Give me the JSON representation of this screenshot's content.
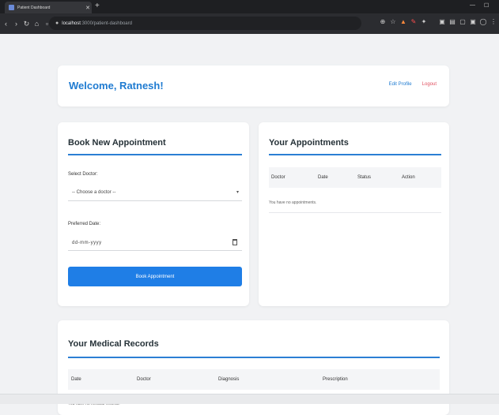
{
  "browser": {
    "tab_title": "Patient Dashboard",
    "url_host": "localhost",
    "url_path": ":3000/patient-dashboard"
  },
  "header": {
    "welcome": "Welcome, Ratnesh!",
    "edit_profile": "Edit Profile",
    "logout": "Logout"
  },
  "book": {
    "title": "Book New Appointment",
    "doctor_label": "Select Doctor:",
    "doctor_placeholder": "-- Choose a doctor --",
    "date_label": "Preferred Date:",
    "date_placeholder": "dd-mm-yyyy",
    "button": "Book Appointment"
  },
  "appointments": {
    "title": "Your Appointments",
    "columns": [
      "Doctor",
      "Date",
      "Status",
      "Action"
    ],
    "empty": "You have no appointments."
  },
  "records": {
    "title": "Your Medical Records",
    "columns": [
      "Date",
      "Doctor",
      "Diagnosis",
      "Prescription"
    ],
    "empty": "You have no medical records."
  },
  "colors": {
    "accent": "#1f7bd1",
    "button": "#1f7ee6",
    "logout": "#e05060"
  }
}
